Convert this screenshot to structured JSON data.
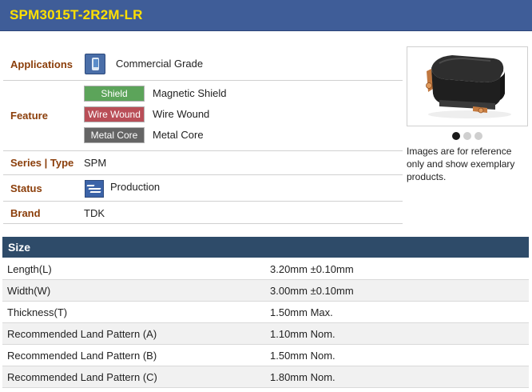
{
  "header": {
    "title": "SPM3015T-2R2M-LR"
  },
  "info": {
    "applications": {
      "label": "Applications",
      "value": "Commercial Grade",
      "icon": "mobile-phone-icon"
    },
    "feature": {
      "label": "Feature",
      "items": [
        {
          "badge": "Shield",
          "text": "Magnetic Shield",
          "color": "#5ca45a"
        },
        {
          "badge": "Wire Wound",
          "text": "Wire Wound",
          "color": "#b94e57"
        },
        {
          "badge": "Metal Core",
          "text": "Metal Core",
          "color": "#656565"
        }
      ]
    },
    "series": {
      "label": "Series | Type",
      "value": "SPM"
    },
    "status": {
      "label": "Status",
      "value": "Production",
      "icon": "production-status-icon"
    },
    "brand": {
      "label": "Brand",
      "value": "TDK"
    }
  },
  "gallery": {
    "image_alt": "inductor-product-image",
    "active_dot": 1,
    "dot_count": 3,
    "disclaimer": "Images are for reference only and show exemplary products."
  },
  "size": {
    "title": "Size",
    "rows": [
      {
        "name": "Length(L)",
        "value": "3.20mm ±0.10mm"
      },
      {
        "name": "Width(W)",
        "value": "3.00mm ±0.10mm"
      },
      {
        "name": "Thickness(T)",
        "value": "1.50mm Max."
      },
      {
        "name": "Recommended Land Pattern (A)",
        "value": "1.10mm Nom."
      },
      {
        "name": "Recommended Land Pattern (B)",
        "value": "1.50mm Nom."
      },
      {
        "name": "Recommended Land Pattern (C)",
        "value": "1.80mm Nom."
      }
    ]
  },
  "colors": {
    "header_bg": "#3f5d98",
    "title": "#ffe000",
    "label": "#8b3e0a",
    "size_header_bg": "#2e4b69"
  }
}
